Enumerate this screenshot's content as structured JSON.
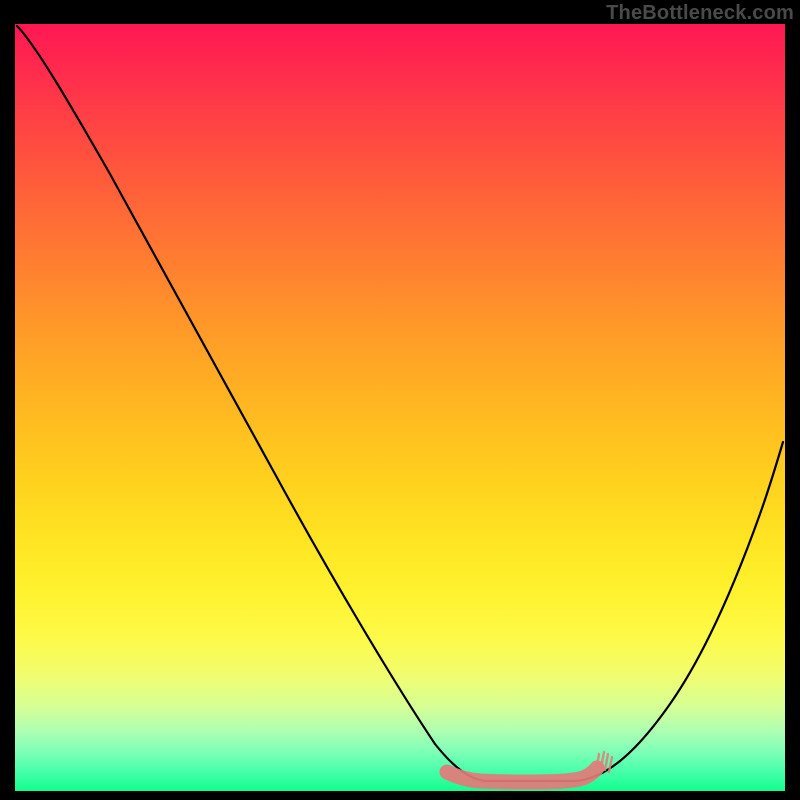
{
  "watermark": "TheBottleneck.com",
  "chart_data": {
    "type": "line",
    "title": "",
    "xlabel": "",
    "ylabel": "",
    "xlim": [
      0,
      100
    ],
    "ylim": [
      0,
      100
    ],
    "grid": false,
    "legend": false,
    "series": [
      {
        "name": "curve",
        "x": [
          0,
          5,
          10,
          15,
          20,
          25,
          30,
          35,
          40,
          45,
          50,
          55,
          58,
          61,
          64,
          67,
          70,
          73,
          77,
          81,
          85,
          89,
          93,
          97,
          100
        ],
        "values": [
          100,
          92,
          84,
          76,
          68,
          60,
          52,
          44,
          36,
          28,
          20,
          12,
          6,
          2,
          0,
          0,
          0,
          0,
          2,
          6,
          12,
          20,
          30,
          42,
          52
        ]
      }
    ],
    "highlight": {
      "name": "valley",
      "x_range": [
        57,
        77
      ],
      "value": 0
    },
    "background_gradient": {
      "top": "#ff1753",
      "mid": "#ffe422",
      "bottom": "#11ff8f"
    }
  }
}
